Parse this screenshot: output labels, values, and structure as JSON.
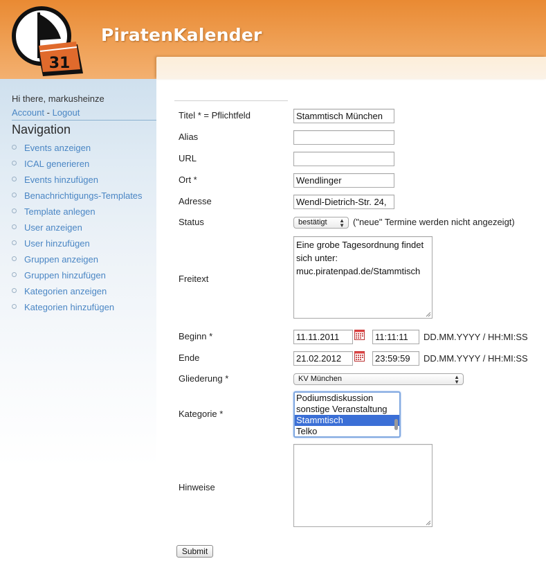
{
  "header": {
    "title": "PiratenKalender",
    "logo_number": "31"
  },
  "sidebar": {
    "greeting": "Hi there, markusheinze",
    "account_label": "Account",
    "separator": "-",
    "logout_label": "Logout",
    "nav_title": "Navigation",
    "items": [
      {
        "label": "Events anzeigen"
      },
      {
        "label": "ICAL generieren"
      },
      {
        "label": "Events hinzufügen"
      },
      {
        "label": "Benachrichtigungs-Templates"
      },
      {
        "label": "Template anlegen"
      },
      {
        "label": "User anzeigen"
      },
      {
        "label": "User hinzufügen"
      },
      {
        "label": "Gruppen anzeigen"
      },
      {
        "label": "Gruppen hinzufügen"
      },
      {
        "label": "Kategorien anzeigen"
      },
      {
        "label": "Kategorien hinzufügen"
      }
    ]
  },
  "form": {
    "title_label": "Titel * = Pflichtfeld",
    "title_value": "Stammtisch München",
    "alias_label": "Alias",
    "alias_value": "",
    "url_label": "URL",
    "url_value": "",
    "ort_label": "Ort *",
    "ort_value": "Wendlinger",
    "adresse_label": "Adresse",
    "adresse_value": "Wendl-Dietrich-Str. 24,",
    "status_label": "Status",
    "status_value": "bestätigt",
    "status_hint": "(\"neue\" Termine werden nicht angezeigt)",
    "freitext_label": "Freitext",
    "freitext_lines": [
      "Eine grobe Tagesordnung findet",
      "sich unter:",
      "muc.piratenpad.de/Stammtisch"
    ],
    "beginn_label": "Beginn *",
    "beginn_date": "11.11.2011",
    "beginn_time": "11:11:11",
    "ende_label": "Ende",
    "ende_date": "21.02.2012",
    "ende_time": "23:59:59",
    "datetime_format": "DD.MM.YYYY / HH:MI:SS",
    "gliederung_label": "Gliederung *",
    "gliederung_value": "KV München",
    "kategorie_label": "Kategorie *",
    "kategorie_options": [
      {
        "label": "Podiumsdiskussion",
        "selected": false
      },
      {
        "label": "sonstige Veranstaltung",
        "selected": false
      },
      {
        "label": "Stammtisch",
        "selected": true
      },
      {
        "label": "Telko",
        "selected": false
      }
    ],
    "hinweise_label": "Hinweise",
    "hinweise_value": "",
    "submit_label": "Submit"
  },
  "colors": {
    "header_orange": "#e98a33",
    "link_blue": "#4a86c4",
    "selection_blue": "#3b6fd6"
  }
}
